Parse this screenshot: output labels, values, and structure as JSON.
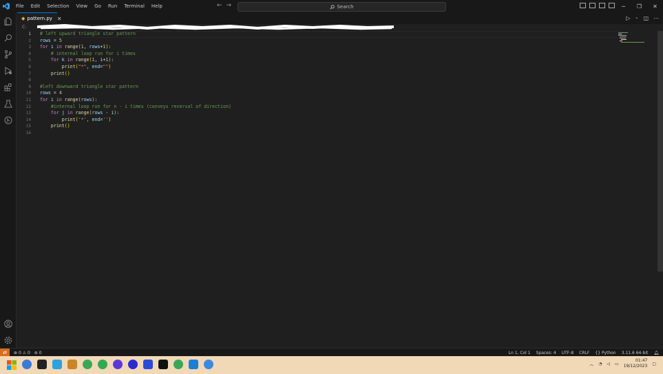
{
  "menu": [
    "File",
    "Edit",
    "Selection",
    "View",
    "Go",
    "Run",
    "Terminal",
    "Help"
  ],
  "search": {
    "placeholder": "Search"
  },
  "tab": {
    "filename": "pattern.py"
  },
  "breadcrumb": {
    "prefix": "C:"
  },
  "editor": {
    "line_numbers": [
      "1",
      "2",
      "3",
      "4",
      "5",
      "6",
      "7",
      "8",
      "9",
      "10",
      "11",
      "12",
      "13",
      "14",
      "15",
      "16"
    ],
    "active_line": 1
  },
  "status": {
    "errors": "0",
    "warnings": "0",
    "ports": "0",
    "position": "Ln 1, Col 1",
    "spaces": "Spaces: 4",
    "encoding": "UTF-8",
    "eol": "CRLF",
    "language": "Python",
    "interpreter": "3.11.6 64-bit"
  },
  "taskbar": {
    "time": "01:47",
    "date": "19/12/2023"
  },
  "colors": {
    "accent": "#0078d4",
    "remote": "#d86e1e",
    "taskbar": "#f1d9b8",
    "keyword": "#c586c0",
    "comment": "#6a9955",
    "string": "#ce9178"
  },
  "icons": [
    "vscode-logo-icon",
    "explorer-icon",
    "search-icon",
    "source-control-icon",
    "run-debug-icon",
    "extensions-icon",
    "testing-icon",
    "git-graph-icon",
    "account-icon",
    "settings-gear-icon"
  ]
}
